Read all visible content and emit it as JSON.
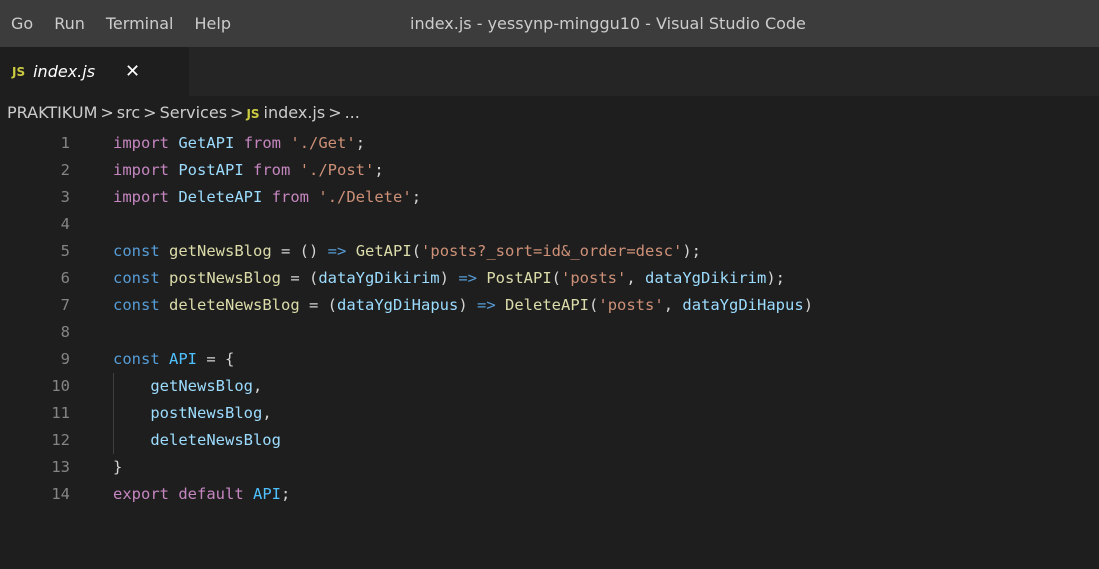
{
  "menu": [
    "Go",
    "Run",
    "Terminal",
    "Help"
  ],
  "window_title": "index.js - yessynp-minggu10 - Visual Studio Code",
  "tab": {
    "badge": "JS",
    "name": "index.js",
    "close": "✕"
  },
  "breadcrumb": {
    "root": "PRAKTIKUM",
    "src": "src",
    "services": "Services",
    "badge": "JS",
    "file": "index.js",
    "more": "...",
    "sep": ">"
  },
  "lines": [
    {
      "n": "1",
      "t": [
        [
          "imp",
          "import"
        ],
        [
          "",
          "  "
        ],
        [
          "var",
          "GetAPI"
        ],
        [
          "",
          "  "
        ],
        [
          "imp",
          "from"
        ],
        [
          "",
          "  "
        ],
        [
          "str",
          "'./Get'"
        ],
        [
          "",
          ";"
        ]
      ]
    },
    {
      "n": "2",
      "t": [
        [
          "imp",
          "import"
        ],
        [
          "",
          "  "
        ],
        [
          "var",
          "PostAPI"
        ],
        [
          "",
          "  "
        ],
        [
          "imp",
          "from"
        ],
        [
          "",
          "  "
        ],
        [
          "str",
          "'./Post'"
        ],
        [
          "",
          ";"
        ]
      ]
    },
    {
      "n": "3",
      "t": [
        [
          "imp",
          "import"
        ],
        [
          "",
          "  "
        ],
        [
          "var",
          "DeleteAPI"
        ],
        [
          "",
          "  "
        ],
        [
          "imp",
          "from"
        ],
        [
          "",
          "  "
        ],
        [
          "str",
          "'./Delete'"
        ],
        [
          "",
          ";"
        ]
      ]
    },
    {
      "n": "4",
      "t": []
    },
    {
      "n": "5",
      "t": [
        [
          "kw",
          "const"
        ],
        [
          "",
          ""
        ],
        [
          "fn",
          "getNewsBlog"
        ],
        [
          "",
          " = () "
        ],
        [
          "kw",
          "=>"
        ],
        [
          "",
          ""
        ],
        [
          "fn",
          "GetAPI"
        ],
        [
          "",
          "("
        ],
        [
          "str",
          "'posts?_sort=id&_order=desc'"
        ],
        [
          "",
          ");"
        ]
      ]
    },
    {
      "n": "6",
      "t": [
        [
          "kw",
          "const"
        ],
        [
          "",
          ""
        ],
        [
          "fn",
          "postNewsBlog"
        ],
        [
          "",
          " = ("
        ],
        [
          "var",
          "dataYgDikirim"
        ],
        [
          "",
          ") "
        ],
        [
          "kw",
          "=>"
        ],
        [
          "",
          ""
        ],
        [
          "fn",
          "PostAPI"
        ],
        [
          "",
          "("
        ],
        [
          "str",
          "'posts'"
        ],
        [
          "",
          ", "
        ],
        [
          "var",
          "dataYgDikirim"
        ],
        [
          "",
          ");"
        ]
      ]
    },
    {
      "n": "7",
      "t": [
        [
          "kw",
          "const"
        ],
        [
          "",
          ""
        ],
        [
          "fn",
          "deleteNewsBlog"
        ],
        [
          "",
          " = ("
        ],
        [
          "var",
          "dataYgDiHapus"
        ],
        [
          "",
          ") "
        ],
        [
          "kw",
          "=>"
        ],
        [
          "",
          ""
        ],
        [
          "fn",
          "DeleteAPI"
        ],
        [
          "",
          "("
        ],
        [
          "str",
          "'posts'"
        ],
        [
          "",
          ", "
        ],
        [
          "var",
          "dataYgDiHapus"
        ],
        [
          "",
          ")"
        ]
      ]
    },
    {
      "n": "8",
      "t": []
    },
    {
      "n": "9",
      "t": [
        [
          "kw",
          "const"
        ],
        [
          "",
          ""
        ],
        [
          "const",
          "API"
        ],
        [
          "",
          " = {"
        ]
      ]
    },
    {
      "n": "10",
      "t": [
        [
          "",
          "    "
        ],
        [
          "var",
          "getNewsBlog"
        ],
        [
          "",
          ","
        ]
      ],
      "guide": true
    },
    {
      "n": "11",
      "t": [
        [
          "",
          "    "
        ],
        [
          "var",
          "postNewsBlog"
        ],
        [
          "",
          ","
        ]
      ],
      "guide": true
    },
    {
      "n": "12",
      "t": [
        [
          "",
          "    "
        ],
        [
          "var",
          "deleteNewsBlog"
        ]
      ],
      "guide": true
    },
    {
      "n": "13",
      "t": [
        [
          "",
          "}"
        ]
      ]
    },
    {
      "n": "14",
      "t": [
        [
          "imp",
          "export"
        ],
        [
          "",
          ""
        ],
        [
          "imp",
          "default"
        ],
        [
          "",
          ""
        ],
        [
          "const",
          "API"
        ],
        [
          "",
          ";"
        ]
      ]
    }
  ]
}
